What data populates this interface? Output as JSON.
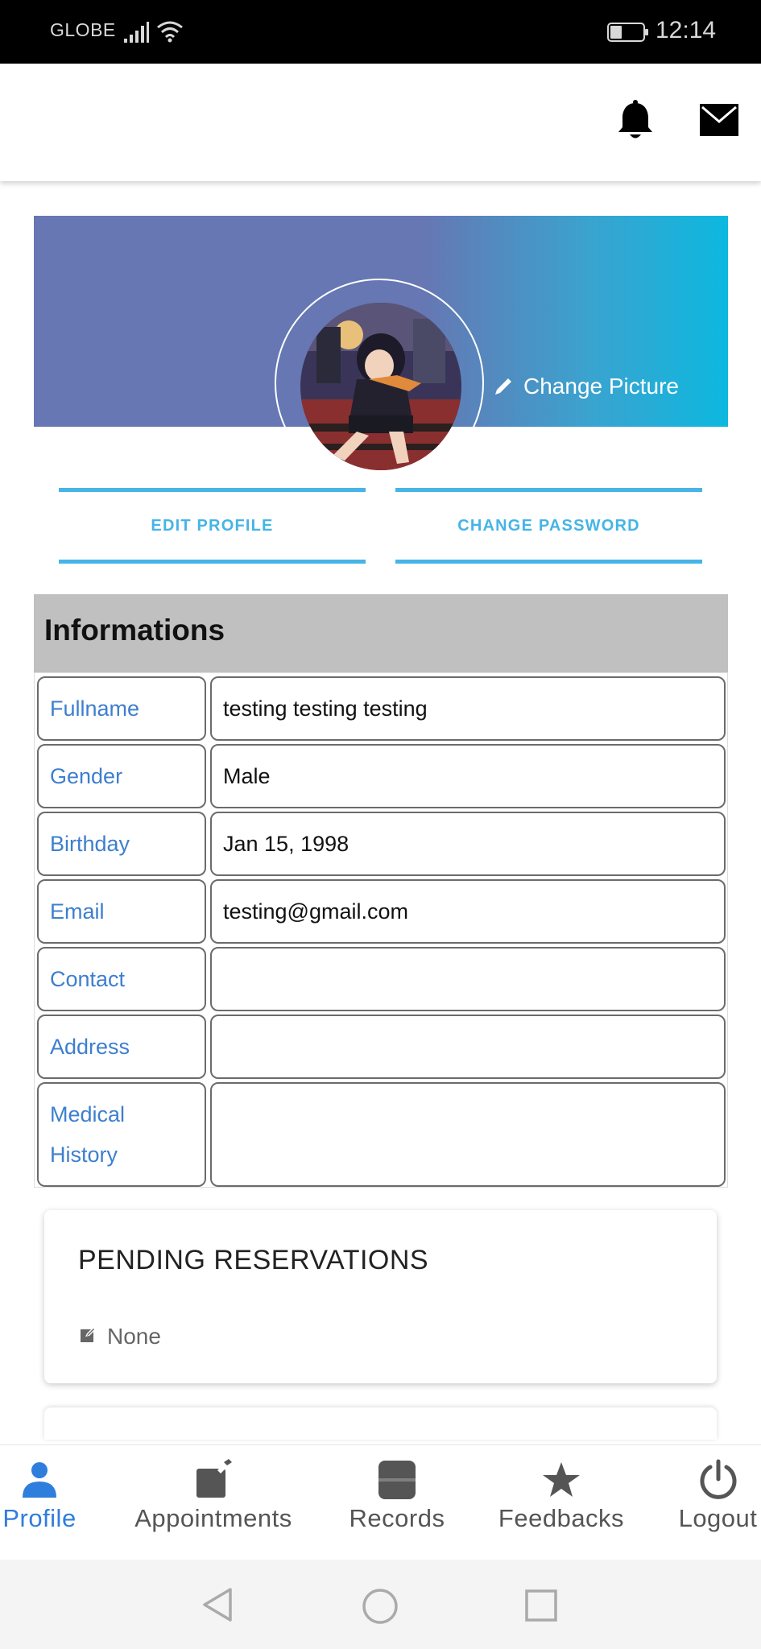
{
  "status_bar": {
    "carrier": "GLOBE",
    "time": "12:14"
  },
  "banner": {
    "change_picture_label": "Change Picture"
  },
  "actions": {
    "edit_profile": "EDIT PROFILE",
    "change_password": "CHANGE PASSWORD"
  },
  "informations": {
    "title": "Informations",
    "rows": [
      {
        "label": "Fullname",
        "value": "testing testing testing"
      },
      {
        "label": "Gender",
        "value": "Male"
      },
      {
        "label": "Birthday",
        "value": "Jan 15, 1998"
      },
      {
        "label": "Email",
        "value": "testing@gmail.com"
      },
      {
        "label": "Contact",
        "value": ""
      },
      {
        "label": "Address",
        "value": ""
      },
      {
        "label": "Medical History",
        "value": ""
      }
    ]
  },
  "pending": {
    "title": "PENDING RESERVATIONS",
    "empty_text": "None"
  },
  "bottom_nav": {
    "items": [
      {
        "label": "Profile",
        "icon": "person-icon",
        "active": true
      },
      {
        "label": "Appointments",
        "icon": "edit-note-icon",
        "active": false
      },
      {
        "label": "Records",
        "icon": "folder-icon",
        "active": false
      },
      {
        "label": "Feedbacks",
        "icon": "star-icon",
        "active": false
      },
      {
        "label": "Logout",
        "icon": "power-icon",
        "active": false
      }
    ]
  },
  "colors": {
    "accent": "#46b4e6",
    "label_blue": "#3d7fce",
    "nav_active": "#2f7ddc",
    "banner_start": "#6677b3",
    "banner_end": "#0db8df"
  }
}
